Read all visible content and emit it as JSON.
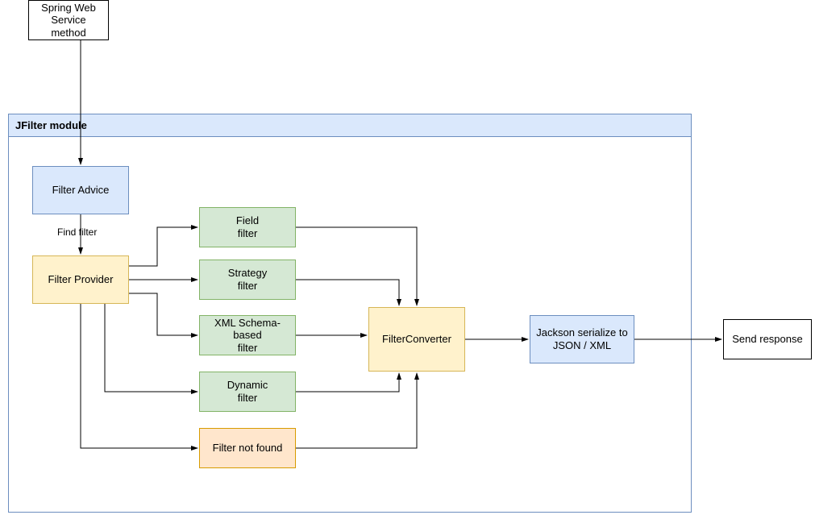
{
  "module_title": "JFilter module",
  "spring_ws": "Spring Web Service\nmethod",
  "filter_advice": "Filter Advice",
  "find_filter": "Find filter",
  "filter_provider": "Filter Provider",
  "field_filter": "Field\nfilter",
  "strategy_filter": "Strategy\nfilter",
  "xml_filter": "XML Schema-based\nfilter",
  "dynamic_filter": "Dynamic\nfilter",
  "filter_not_found": "Filter not found",
  "filter_converter": "FilterConverter",
  "jackson": "Jackson serialize to\nJSON / XML",
  "send_response": "Send response"
}
